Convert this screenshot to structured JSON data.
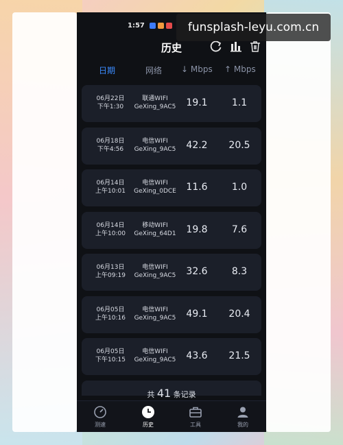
{
  "status": {
    "time": "1:57"
  },
  "nav": {
    "title": "历史"
  },
  "columns": {
    "date": "日期",
    "network": "网络",
    "download": "↓ Mbps",
    "upload": "↑ Mbps"
  },
  "rows": [
    {
      "date": "06月22日",
      "time": "下午1:30",
      "isp": "联通WIFI",
      "ssid": "GeXing_9AC5",
      "down": "19.1",
      "up": "1.1"
    },
    {
      "date": "06月18日",
      "time": "下午4:56",
      "isp": "电信WIFI",
      "ssid": "GeXing_9AC5",
      "down": "42.2",
      "up": "20.5"
    },
    {
      "date": "06月14日",
      "time": "上午10:01",
      "isp": "电信WIFI",
      "ssid": "GeXing_0DCE",
      "down": "11.6",
      "up": "1.0"
    },
    {
      "date": "06月14日",
      "time": "上午10:00",
      "isp": "移动WIFI",
      "ssid": "GeXing_64D1",
      "down": "19.8",
      "up": "7.6"
    },
    {
      "date": "06月13日",
      "time": "上午09:19",
      "isp": "电信WIFI",
      "ssid": "GeXing_9AC5",
      "down": "32.6",
      "up": "8.3"
    },
    {
      "date": "06月05日",
      "time": "上午10:16",
      "isp": "电信WIFI",
      "ssid": "GeXing_9AC5",
      "down": "49.1",
      "up": "20.4"
    },
    {
      "date": "06月05日",
      "time": "下午10:15",
      "isp": "电信WIFI",
      "ssid": "GeXing_9AC5",
      "down": "43.6",
      "up": "21.5"
    }
  ],
  "summary": {
    "prefix": "共",
    "count": "41",
    "suffix": "条记录"
  },
  "tabs": [
    {
      "label": "测速",
      "icon": "speedometer-icon"
    },
    {
      "label": "历史",
      "icon": "clock-icon"
    },
    {
      "label": "工具",
      "icon": "toolbox-icon"
    },
    {
      "label": "我的",
      "icon": "user-icon"
    }
  ],
  "watermark": "funsplash-leyu.com.cn",
  "colors": {
    "accent": "#3b8cff",
    "background": "#0f1115",
    "row_bg": "#1b1f29"
  }
}
